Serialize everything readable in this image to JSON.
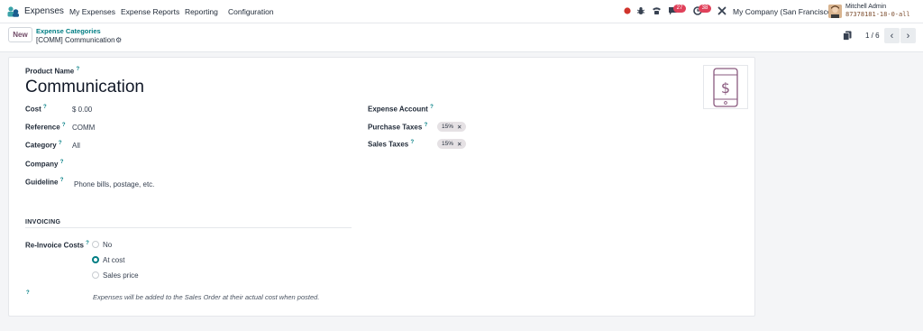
{
  "navbar": {
    "app_name": "Expenses",
    "menu": [
      "My Expenses",
      "Expense Reports",
      "Reporting",
      "Configuration"
    ],
    "chat_count": "27",
    "activity_count": "38",
    "company": "My Company (San Francisco)",
    "user_name": "Mitchell Admin",
    "db_name": "87378181-18-0-all"
  },
  "control": {
    "new_label": "New",
    "breadcrumb_parent": "Expense Categories",
    "breadcrumb_current": "[COMM] Communication",
    "pager": "1 / 6"
  },
  "form": {
    "product_name_label": "Product Name",
    "product_name": "Communication",
    "cost_label": "Cost",
    "cost": "$ 0.00",
    "reference_label": "Reference",
    "reference": "COMM",
    "category_label": "Category",
    "category": "All",
    "company_label": "Company",
    "company": "",
    "guideline_label": "Guideline",
    "guideline": "Phone bills, postage, etc.",
    "expense_account_label": "Expense Account",
    "expense_account": "",
    "purchase_taxes_label": "Purchase Taxes",
    "purchase_taxes": [
      "15%"
    ],
    "sales_taxes_label": "Sales Taxes",
    "sales_taxes": [
      "15%"
    ],
    "tooltip_marker": "?",
    "invoicing_section": "INVOICING",
    "reinvoice_label": "Re-Invoice Costs",
    "reinvoice_options": [
      "No",
      "At cost",
      "Sales price"
    ],
    "reinvoice_selected": "At cost",
    "reinvoice_help": "Expenses will be added to the Sales Order at their actual cost when posted."
  },
  "colors": {
    "brand": "#714b67",
    "accent": "#017e84",
    "badge": "#e0415a"
  }
}
